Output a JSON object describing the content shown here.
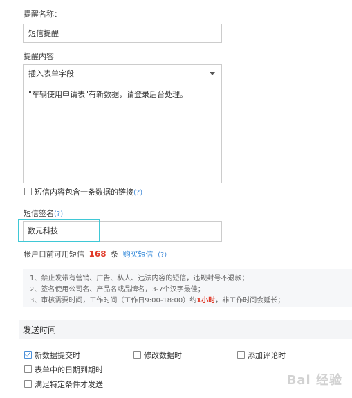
{
  "reminder_name": {
    "label": "提醒名称：",
    "value": "短信提醒"
  },
  "reminder_content": {
    "label": "提醒内容",
    "insert_field_placeholder": "插入表单字段",
    "text": "\"车辆使用申请表\"有新数据，请登录后台处理。"
  },
  "include_link": {
    "label": "短信内容包含一条数据的链接",
    "help": "(?)",
    "checked": false
  },
  "signature": {
    "label": "短信签名",
    "help": "(?)",
    "value": "数元科技"
  },
  "balance": {
    "prefix": "帐户目前可用短信",
    "count": "168",
    "unit": "条",
    "buy_link": "购买短信",
    "help": "(?)"
  },
  "rules": {
    "line1": "1、禁止发带有营销、广告、私人、违法内容的短信，违规封号不退款；",
    "line2": "2、签名使用公司名、产品名或品牌名，3-7个汉字最佳；",
    "line3_before": "3、审核需要时间，工作时间（工作日9:00-18:00）约",
    "line3_highlight": "1小时",
    "line3_after": "，非工作时间会延长；"
  },
  "send_time": {
    "title": "发送时间",
    "options": [
      {
        "label": "新数据提交时",
        "checked": true
      },
      {
        "label": "修改数据时",
        "checked": false
      },
      {
        "label": "添加评论时",
        "checked": false
      },
      {
        "label": "表单中的日期到期时",
        "checked": false
      },
      {
        "label": "满足特定条件才发送",
        "checked": false
      }
    ]
  },
  "colors": {
    "accent": "#2d86d9",
    "highlight_border": "#3fc8d6",
    "count_red": "#e03b2a"
  },
  "watermark": {
    "text": "Bai 经验"
  }
}
